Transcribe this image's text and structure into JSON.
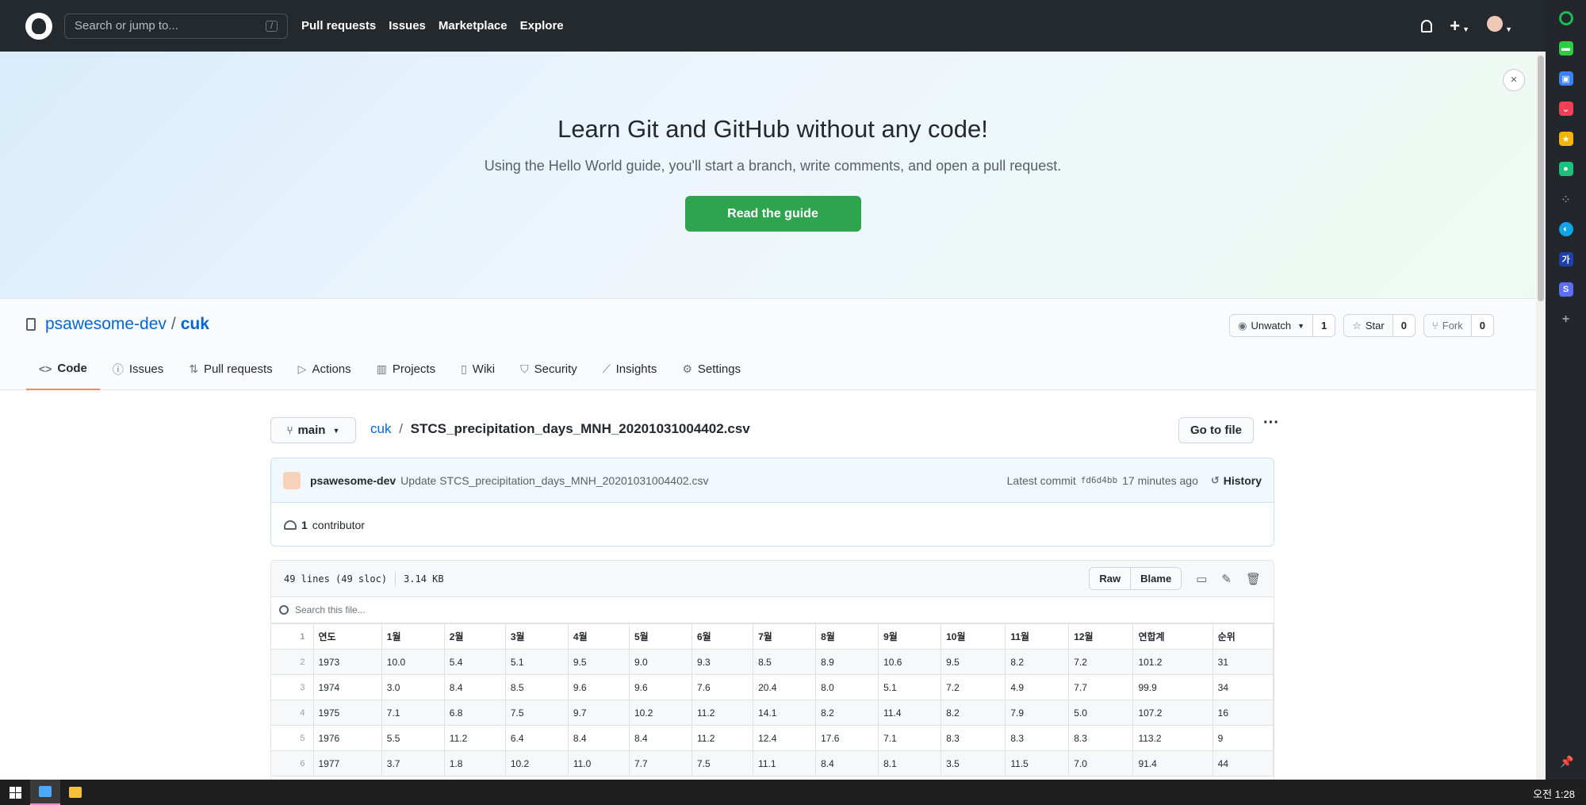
{
  "header": {
    "search_placeholder": "Search or jump to...",
    "search_key": "/",
    "nav": [
      "Pull requests",
      "Issues",
      "Marketplace",
      "Explore"
    ]
  },
  "banner": {
    "title": "Learn Git and GitHub without any code!",
    "subtitle": "Using the Hello World guide, you'll start a branch, write comments, and open a pull request.",
    "button": "Read the guide",
    "close": "×"
  },
  "repo": {
    "owner": "psawesome-dev",
    "separator": "/",
    "name": "cuk",
    "unwatch_label": "Unwatch",
    "unwatch_count": "1",
    "star_label": "Star",
    "star_count": "0",
    "fork_label": "Fork",
    "fork_count": "0"
  },
  "tabs": [
    {
      "label": "Code",
      "icon": "<>"
    },
    {
      "label": "Issues",
      "icon": "ⓘ"
    },
    {
      "label": "Pull requests",
      "icon": "⇅"
    },
    {
      "label": "Actions",
      "icon": "▷"
    },
    {
      "label": "Projects",
      "icon": "▥"
    },
    {
      "label": "Wiki",
      "icon": "▯"
    },
    {
      "label": "Security",
      "icon": "⛉"
    },
    {
      "label": "Insights",
      "icon": "⟋"
    },
    {
      "label": "Settings",
      "icon": "⚙"
    }
  ],
  "file": {
    "branch": "main",
    "repo_link": "cuk",
    "separator": "/",
    "filename": "STCS_precipitation_days_MNH_20201031004402.csv",
    "goto": "Go to file",
    "more": "···"
  },
  "commit": {
    "author": "psawesome-dev",
    "message": "Update STCS_precipitation_days_MNH_20201031004402.csv",
    "latest_label": "Latest commit",
    "sha": "fd6d4bb",
    "time": "17 minutes ago",
    "history": "History",
    "contrib_count": "1",
    "contrib_label": "contributor"
  },
  "file_info": {
    "lines": "49 lines (49 sloc)",
    "size": "3.14 KB",
    "raw": "Raw",
    "blame": "Blame",
    "search_placeholder": "Search this file..."
  },
  "table": {
    "header": [
      "연도",
      "1월",
      "2월",
      "3월",
      "4월",
      "5월",
      "6월",
      "7월",
      "8월",
      "9월",
      "10월",
      "11월",
      "12월",
      "연합계",
      "순위"
    ],
    "rows": [
      [
        "1973",
        "10.0",
        "5.4",
        "5.1",
        "9.5",
        "9.0",
        "9.3",
        "8.5",
        "8.9",
        "10.6",
        "9.5",
        "8.2",
        "7.2",
        "101.2",
        "31"
      ],
      [
        "1974",
        "3.0",
        "8.4",
        "8.5",
        "9.6",
        "9.6",
        "7.6",
        "20.4",
        "8.0",
        "5.1",
        "7.2",
        "4.9",
        "7.7",
        "99.9",
        "34"
      ],
      [
        "1975",
        "7.1",
        "6.8",
        "7.5",
        "9.7",
        "10.2",
        "11.2",
        "14.1",
        "8.2",
        "11.4",
        "8.2",
        "7.9",
        "5.0",
        "107.2",
        "16"
      ],
      [
        "1976",
        "5.5",
        "11.2",
        "6.4",
        "8.4",
        "8.4",
        "11.2",
        "12.4",
        "17.6",
        "7.1",
        "8.3",
        "8.3",
        "8.3",
        "113.2",
        "9"
      ],
      [
        "1977",
        "3.7",
        "1.8",
        "10.2",
        "11.0",
        "7.7",
        "7.5",
        "11.1",
        "8.4",
        "8.1",
        "3.5",
        "11.5",
        "7.0",
        "91.4",
        "44"
      ]
    ]
  },
  "sidebar_icons": [
    {
      "name": "green-circle-icon",
      "color": "#1db954"
    },
    {
      "name": "green-square-icon",
      "color": "#2ecc40"
    },
    {
      "name": "briefcase-icon",
      "color": "#3b82f6"
    },
    {
      "name": "pocket-icon",
      "color": "#ef4056"
    },
    {
      "name": "star-icon",
      "color": "#f5b400"
    },
    {
      "name": "chat-icon",
      "color": "#19c37d"
    },
    {
      "name": "dots-icon",
      "color": "#23262b"
    },
    {
      "name": "edge-icon",
      "color": "#0ea5e9"
    },
    {
      "name": "dictionary-icon",
      "color": "#1e40af"
    },
    {
      "name": "s-app-icon",
      "color": "#5b6ef5"
    },
    {
      "name": "add-icon",
      "color": "#23262b"
    }
  ],
  "sidebar_labels": {
    "dictionary": "가",
    "s_app": "S",
    "add": "+"
  },
  "taskbar": {
    "clock": "오전 1:28"
  }
}
